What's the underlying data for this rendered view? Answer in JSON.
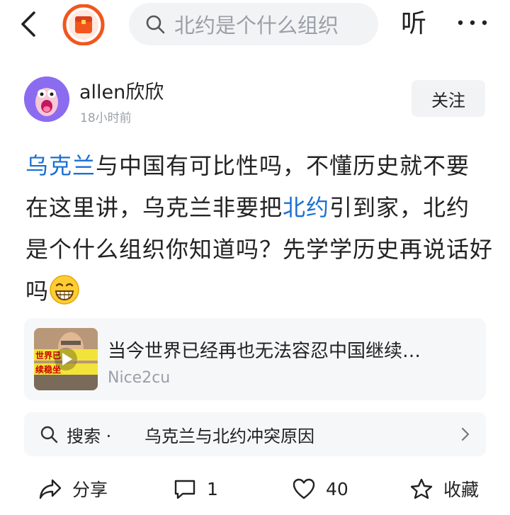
{
  "topbar": {
    "search_text": "北约是个什么组织",
    "listen_label": "听"
  },
  "author": {
    "name": "allen欣欣",
    "time": "18小时前",
    "follow_label": "关注"
  },
  "post": {
    "seg1_link": "乌克兰",
    "seg2": "与中国有可比性吗，不懂历史就不要在这里讲，乌克兰非要把",
    "seg3_link": "北约",
    "seg4": "引到家，北约是个什么组织你知道吗？先学学历史再说话好吗"
  },
  "card": {
    "title": "当今世界已经再也无法容忍中国继续…",
    "source": "Nice2cu",
    "thumb_caption_1": "世界已",
    "thumb_caption_2": "续稳坐"
  },
  "related": {
    "prefix": "搜索 ·",
    "query": "乌克兰与北约冲突原因"
  },
  "actions": {
    "share_label": "分享",
    "comment_count": "1",
    "like_count": "40",
    "fav_label": "收藏"
  },
  "colors": {
    "link": "#1b6fd1",
    "muted": "#9aa0a8",
    "app_icon": "#f2561d"
  }
}
